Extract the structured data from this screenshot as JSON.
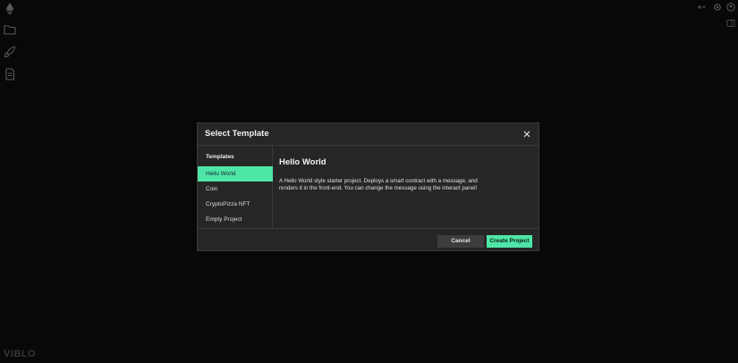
{
  "app": {
    "brand": "VIBLO"
  },
  "sidebar": {
    "icons": [
      "ethereum-logo-icon",
      "folder-icon",
      "rocket-icon",
      "file-icon"
    ]
  },
  "topbar": {
    "icons": [
      "add-dropdown-icon",
      "settings-icon",
      "user-icon",
      "collapse-panel-icon"
    ]
  },
  "modal": {
    "title": "Select Template",
    "templates_heading": "Templates",
    "templates": [
      {
        "label": "Hello World",
        "selected": true
      },
      {
        "label": "Coin",
        "selected": false
      },
      {
        "label": "CryptoPizza NFT",
        "selected": false
      },
      {
        "label": "Empty Project",
        "selected": false
      }
    ],
    "detail": {
      "title": "Hello World",
      "description": "A Hello World style starter project. Deploys a smart contract with a message, and renders it in the front-end. You can change the message using the interact panel!"
    },
    "buttons": {
      "cancel": "Cancel",
      "create": "Create Project"
    }
  },
  "colors": {
    "accent": "#4ee6a6",
    "background": "#0d0d0d",
    "modal_bg": "#262626"
  }
}
